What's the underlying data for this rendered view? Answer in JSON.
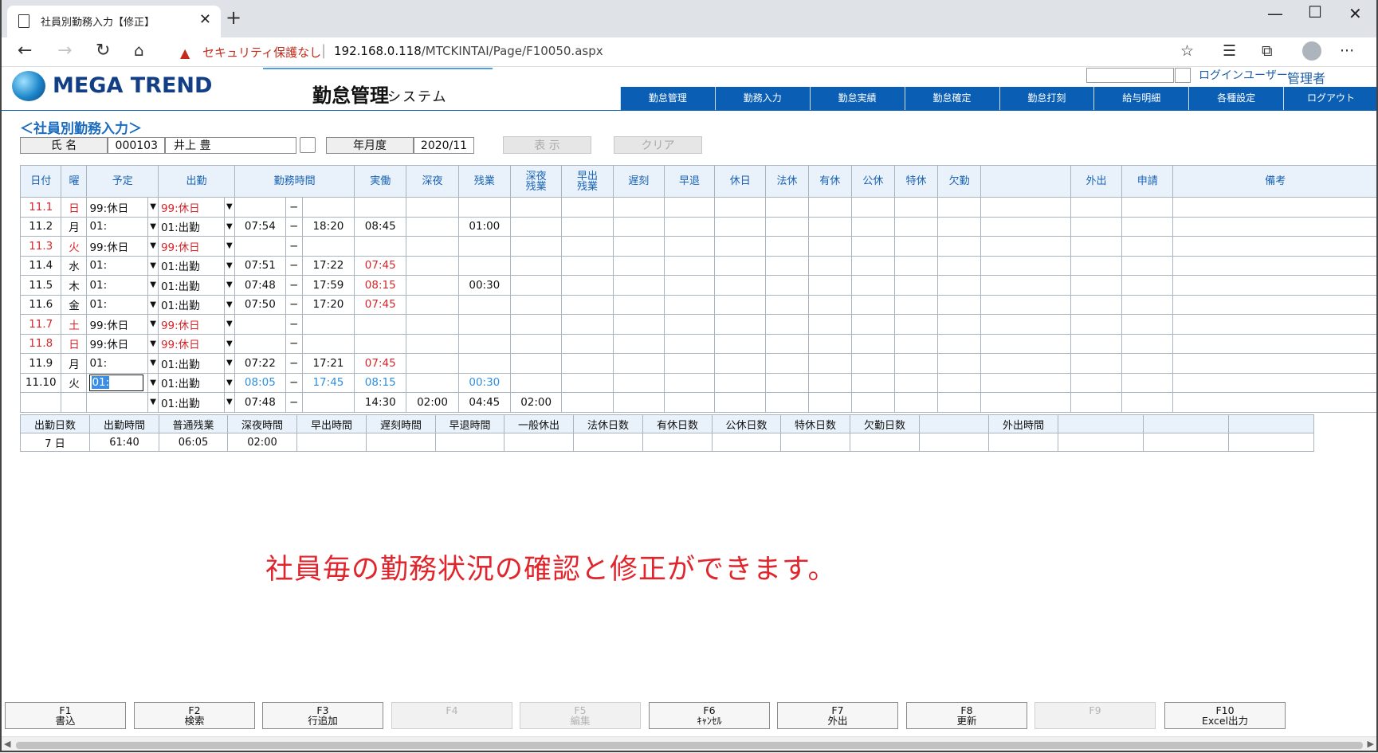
{
  "browser": {
    "tab_title": "社員別勤務入力【修正】",
    "security_text": "セキュリティ保護なし",
    "url_host": "192.168.0.118",
    "url_path": "/MTCKINTAI/Page/F10050.aspx"
  },
  "header": {
    "logo_text": "MEGA TREND",
    "system_title": "勤怠管理",
    "system_sub": "システム",
    "login_label": "ログインユーザー:",
    "login_user": "管理者",
    "menu": [
      "勤怠管理",
      "勤務入力",
      "勤怠実績",
      "勤怠確定",
      "勤怠打刻",
      "給与明細",
      "各種設定",
      "ログアウト"
    ]
  },
  "page": {
    "title": "＜社員別勤務入力＞",
    "name_label": "氏 名",
    "emp_code": "000103",
    "emp_name": "井上 豊",
    "year_label": "年月度",
    "year_value": "2020/11",
    "show_button": "表 示",
    "clear_button": "クリア"
  },
  "grid": {
    "headers": {
      "date": "日付",
      "dow": "曜",
      "plan": "予定",
      "attend": "出勤",
      "worktime": "勤務時間",
      "actual": "実働",
      "night": "深夜",
      "overtime": "残業",
      "night_ot_1": "深夜",
      "night_ot_2": "残業",
      "early_ot_1": "早出",
      "early_ot_2": "残業",
      "late": "遅刻",
      "leave_early": "早退",
      "holiday": "休日",
      "legal_holiday": "法休",
      "paid_leave": "有休",
      "public_leave": "公休",
      "special_leave": "特休",
      "absence": "欠勤",
      "blank": "",
      "out": "外出",
      "apply": "申請",
      "remarks": "備考"
    },
    "rows": [
      {
        "date": "11.1",
        "dow": "日",
        "plan": "99:休日",
        "attend": "99:休日",
        "start": "",
        "end": "",
        "actual": "",
        "night": "",
        "overtime": "",
        "night_ot": "",
        "red": true
      },
      {
        "date": "11.2",
        "dow": "月",
        "plan": "01:",
        "attend": "01:出勤",
        "start": "07:54",
        "end": "18:20",
        "actual": "08:45",
        "night": "",
        "overtime": "01:00",
        "night_ot": "",
        "red": false
      },
      {
        "date": "11.3",
        "dow": "火",
        "plan": "99:休日",
        "attend": "99:休日",
        "start": "",
        "end": "",
        "actual": "",
        "night": "",
        "overtime": "",
        "night_ot": "",
        "red": true
      },
      {
        "date": "11.4",
        "dow": "水",
        "plan": "01:",
        "attend": "01:出勤",
        "start": "07:51",
        "end": "17:22",
        "actual": "07:45",
        "night": "",
        "overtime": "",
        "night_ot": "",
        "red": false,
        "actual_red": true
      },
      {
        "date": "11.5",
        "dow": "木",
        "plan": "01:",
        "attend": "01:出勤",
        "start": "07:48",
        "end": "17:59",
        "actual": "08:15",
        "night": "",
        "overtime": "00:30",
        "night_ot": "",
        "red": false,
        "actual_red": true
      },
      {
        "date": "11.6",
        "dow": "金",
        "plan": "01:",
        "attend": "01:出勤",
        "start": "07:50",
        "end": "17:20",
        "actual": "07:45",
        "night": "",
        "overtime": "",
        "night_ot": "",
        "red": false,
        "actual_red": true
      },
      {
        "date": "11.7",
        "dow": "土",
        "plan": "99:休日",
        "attend": "99:休日",
        "start": "",
        "end": "",
        "actual": "",
        "night": "",
        "overtime": "",
        "night_ot": "",
        "red": true
      },
      {
        "date": "11.8",
        "dow": "日",
        "plan": "99:休日",
        "attend": "99:休日",
        "start": "",
        "end": "",
        "actual": "",
        "night": "",
        "overtime": "",
        "night_ot": "",
        "red": true
      },
      {
        "date": "11.9",
        "dow": "月",
        "plan": "01:",
        "attend": "01:出勤",
        "start": "07:22",
        "end": "17:21",
        "actual": "07:45",
        "night": "",
        "overtime": "",
        "night_ot": "",
        "red": false,
        "actual_red": true
      },
      {
        "date": "11.10",
        "dow": "火",
        "plan": "01:",
        "attend": "01:出勤",
        "start": "08:05",
        "end": "17:45",
        "actual": "08:15",
        "night": "",
        "overtime": "00:30",
        "night_ot": "",
        "red": false,
        "blue": true,
        "selected": true
      }
    ],
    "total_row": {
      "attend": "01:出勤",
      "start": "07:48",
      "actual": "14:30",
      "night": "02:00",
      "overtime": "04:45",
      "night_ot": "02:00"
    },
    "dash": "−",
    "dropdown_arrow": "▼"
  },
  "summary": {
    "headers": [
      "出勤日数",
      "出勤時間",
      "普通残業",
      "深夜時間",
      "早出時間",
      "遅刻時間",
      "早退時間",
      "一般休出",
      "法休日数",
      "有休日数",
      "公休日数",
      "特休日数",
      "欠勤日数",
      "",
      "外出時間",
      "",
      "",
      ""
    ],
    "values": [
      "7 日",
      "61:40",
      "06:05",
      "02:00",
      "",
      "",
      "",
      "",
      "",
      "",
      "",
      "",
      "",
      "",
      "",
      "",
      "",
      ""
    ]
  },
  "message": "社員毎の勤務状況の確認と修正ができます。",
  "fkeys": [
    {
      "key": "F1",
      "label": "書込",
      "enabled": true
    },
    {
      "key": "F2",
      "label": "検索",
      "enabled": true
    },
    {
      "key": "F3",
      "label": "行追加",
      "enabled": true
    },
    {
      "key": "F4",
      "label": "",
      "enabled": false
    },
    {
      "key": "F5",
      "label": "編集",
      "enabled": false
    },
    {
      "key": "F6",
      "label": "ｷｬﾝｾﾙ",
      "enabled": true
    },
    {
      "key": "F7",
      "label": "外出",
      "enabled": true
    },
    {
      "key": "F8",
      "label": "更新",
      "enabled": true
    },
    {
      "key": "F9",
      "label": "",
      "enabled": false
    },
    {
      "key": "F10",
      "label": "Excel出力",
      "enabled": true
    }
  ],
  "icons": {
    "back": "arrow-left-icon",
    "forward": "arrow-right-icon",
    "reload": "reload-icon",
    "home": "home-icon",
    "warning": "warning-icon",
    "star": "favorite-star-icon",
    "favorites": "favorites-list-icon",
    "collections": "collections-icon",
    "profile": "profile-avatar-icon",
    "more": "more-dots-icon"
  },
  "colors": {
    "accent": "#0a5fb5",
    "red": "#d6262b",
    "blue": "#2e8fe0",
    "message": "#e0262c"
  }
}
